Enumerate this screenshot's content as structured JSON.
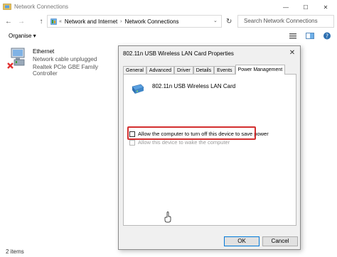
{
  "window": {
    "title": "Network Connections",
    "min_glyph": "—",
    "max_glyph": "☐",
    "close_glyph": "✕"
  },
  "nav": {
    "back": "←",
    "forward": "→",
    "up": "↑",
    "breadcrumbs": [
      "Network and Internet",
      "Network Connections"
    ],
    "breadcrumb_prefix": "«",
    "separator": "›",
    "dropdown": "⌄",
    "refresh": "↻",
    "search_placeholder": "Search Network Connections"
  },
  "toolbar": {
    "organise_label": "Organise ▾"
  },
  "items": [
    {
      "name": "Ethernet",
      "status": "Network cable unplugged",
      "device": "Realtek PCIe GBE Family Controller"
    }
  ],
  "status_bar": {
    "count": "2 items"
  },
  "dialog": {
    "title": "802.11n USB Wireless LAN Card Properties",
    "close_glyph": "✕",
    "tabs": [
      "General",
      "Advanced",
      "Driver",
      "Details",
      "Events",
      "Power Management"
    ],
    "active_tab": "Power Management",
    "device_name": "802.11n USB Wireless LAN Card",
    "options": [
      {
        "label": "Allow the computer to turn off this device to save power",
        "checked": false,
        "enabled": true
      },
      {
        "label": "Allow this device to wake the computer",
        "checked": false,
        "enabled": false
      }
    ],
    "ok_label": "OK",
    "cancel_label": "Cancel"
  },
  "colors": {
    "highlight": "#d32f2f",
    "accent": "#0078d7"
  }
}
